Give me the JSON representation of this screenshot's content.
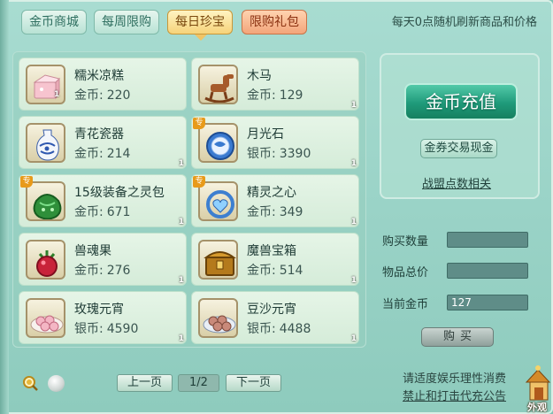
{
  "tabs": [
    {
      "label": "金币商城",
      "state": "normal"
    },
    {
      "label": "每周限购",
      "state": "normal"
    },
    {
      "label": "每日珍宝",
      "state": "active"
    },
    {
      "label": "限购礼包",
      "state": "special"
    }
  ],
  "refresh_note": "每天0点随机刷新商品和价格",
  "items": [
    {
      "name": "糯米凉糕",
      "currency": "金币:",
      "price": "220",
      "qty": "1",
      "badge": "",
      "icon": "rice-cake-icon"
    },
    {
      "name": "木马",
      "currency": "金币:",
      "price": "129",
      "qty": "1",
      "badge": "",
      "icon": "rocking-horse-icon"
    },
    {
      "name": "青花瓷器",
      "currency": "金币:",
      "price": "214",
      "qty": "1",
      "badge": "",
      "icon": "porcelain-vase-icon"
    },
    {
      "name": "月光石",
      "currency": "银币:",
      "price": "3390",
      "qty": "1",
      "badge": "专",
      "icon": "moonstone-icon"
    },
    {
      "name": "15级装备之灵包",
      "currency": "金币:",
      "price": "671",
      "qty": "1",
      "badge": "专",
      "icon": "equipment-spirit-bag-icon"
    },
    {
      "name": "精灵之心",
      "currency": "金币:",
      "price": "349",
      "qty": "1",
      "badge": "专",
      "icon": "spirit-heart-icon"
    },
    {
      "name": "兽魂果",
      "currency": "金币:",
      "price": "276",
      "qty": "1",
      "badge": "",
      "icon": "beast-soul-fruit-icon"
    },
    {
      "name": "魔兽宝箱",
      "currency": "金币:",
      "price": "514",
      "qty": "1",
      "badge": "",
      "icon": "treasure-chest-icon"
    },
    {
      "name": "玫瑰元宵",
      "currency": "银币:",
      "price": "4590",
      "qty": "1",
      "badge": "",
      "icon": "rose-dumplings-icon"
    },
    {
      "name": "豆沙元宵",
      "currency": "银币:",
      "price": "4488",
      "qty": "1",
      "badge": "",
      "icon": "bean-paste-dumplings-icon"
    }
  ],
  "right_panel": {
    "recharge_label": "金币充值",
    "exchange_label": "金券交易现金",
    "alliance_link": "战盟点数相关",
    "buy_quantity_label": "购买数量",
    "buy_quantity_value": "",
    "total_price_label": "物品总价",
    "total_price_value": "",
    "current_gold_label": "当前金币",
    "current_gold_value": "127",
    "buy_label": "购买"
  },
  "pagination": {
    "prev_label": "上一页",
    "page_indicator": "1/2",
    "next_label": "下一页"
  },
  "notices": {
    "line1": "请适度娱乐理性消费",
    "line2": "禁止和打击代充公告"
  },
  "appearance_label": "外观",
  "colors": {
    "panel_bg": "#9ad3c7",
    "active_tab": "#f6d37a",
    "special_tab": "#f3a57a",
    "recharge_button": "#1f9a7a"
  }
}
